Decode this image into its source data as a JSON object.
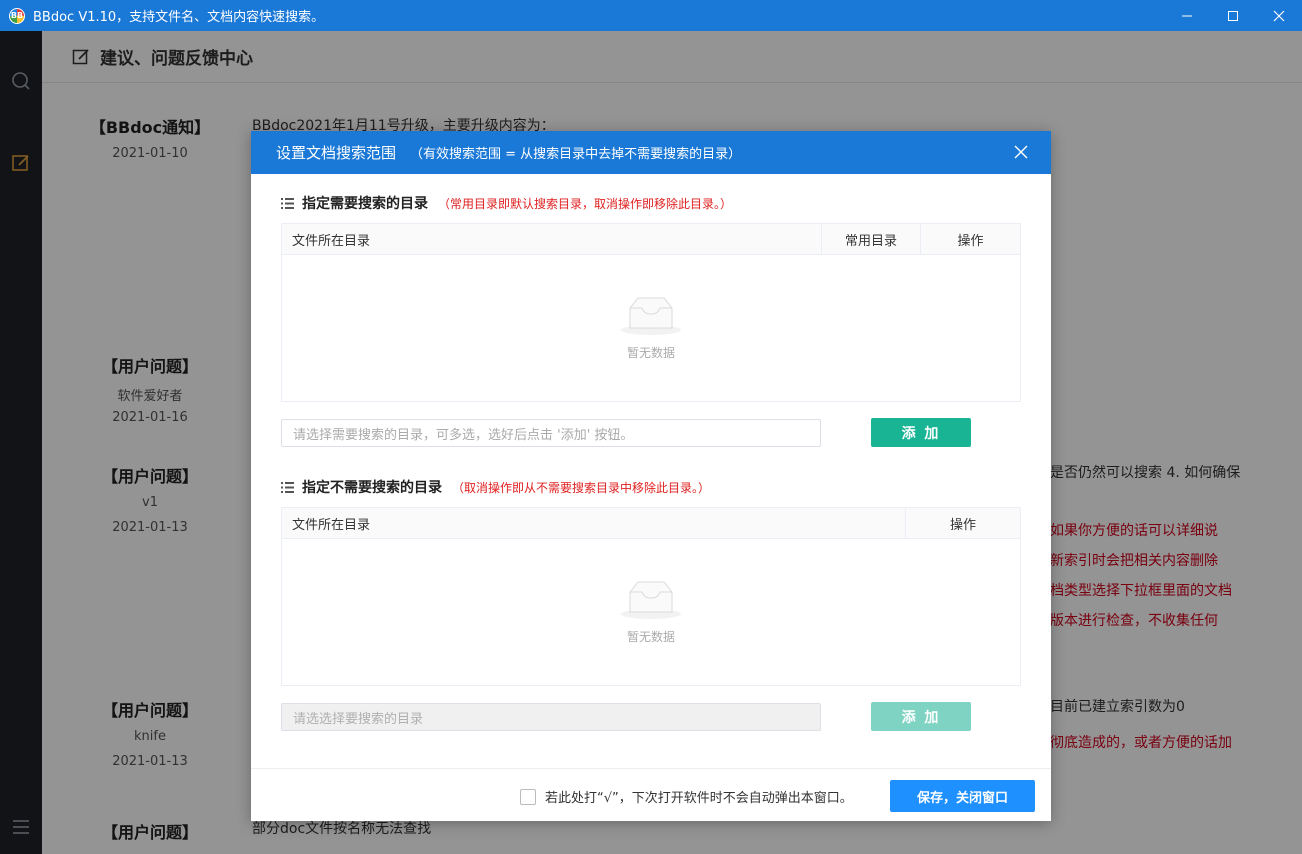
{
  "window": {
    "title": "BBdoc V1.10，支持文件名、文档内容快速搜索。",
    "app_icon": "BB",
    "minimize_icon": "minimize-icon",
    "maximize_icon": "maximize-icon",
    "close_icon": "close-icon"
  },
  "sidebar": {
    "items": [
      {
        "icon": "search-icon"
      },
      {
        "icon": "edit-icon",
        "active": true
      },
      {
        "icon": "menu-icon"
      }
    ]
  },
  "page": {
    "title": "建议、问题反馈中心"
  },
  "feedback": [
    {
      "title": "【BBdoc通知】",
      "author": "",
      "date": "2021-01-10",
      "content": "BBdoc2021年1月11号升级，主要升级内容为："
    },
    {
      "title": "【用户问题】",
      "author": "软件爱好者",
      "date": "2021-01-16",
      "content": ""
    },
    {
      "title": "【用户问题】",
      "author": "v1",
      "date": "2021-01-13",
      "content": "是否仍然可以搜索 4. 如何确保"
    },
    {
      "title": "【用户问题】",
      "author": "knife",
      "date": "2021-01-13",
      "content": "目前已建立索引数为0"
    },
    {
      "title": "【用户问题】",
      "author": "",
      "date": "",
      "content": "部分doc文件按名称无法查找"
    }
  ],
  "reply_fragments": [
    "如果你方便的话可以详细说",
    "新索引时会把相关内容删除",
    "档类型选择下拉框里面的文档",
    "版本进行检查，不收集任何",
    "彻底造成的，或者方便的话加"
  ],
  "dialog": {
    "title": "设置文档搜索范围",
    "subtitle": "（有效搜索范围 = 从搜索目录中去掉不需要搜索的目录）",
    "close_icon": "close-icon",
    "include": {
      "title": "指定需要搜索的目录",
      "note": "（常用目录即默认搜索目录，取消操作即移除此目录。）",
      "columns": [
        "文件所在目录",
        "常用目录",
        "操作"
      ],
      "empty_text": "暂无数据",
      "input_placeholder": "请选择需要搜索的目录，可多选，选好后点击 '添加' 按钮。",
      "add_label": "添 加"
    },
    "exclude": {
      "title": "指定不需要搜索的目录",
      "note": "（取消操作即从不需要搜索目录中移除此目录。）",
      "columns": [
        "文件所在目录",
        "操作"
      ],
      "empty_text": "暂无数据",
      "input_placeholder": "请选选择要搜索的目录",
      "add_label": "添 加"
    },
    "footer": {
      "checkbox_label": "若此处打“√”，下次打开软件时不会自动弹出本窗口。",
      "checked": false,
      "save_label": "保存，关闭窗口"
    }
  },
  "colors": {
    "titlebar": "#1a78d6",
    "sidebar": "#1e2127",
    "accent_green": "#18b494",
    "save_blue": "#1e90ff",
    "note_red": "#e02020",
    "active_icon": "#e8a33d"
  }
}
